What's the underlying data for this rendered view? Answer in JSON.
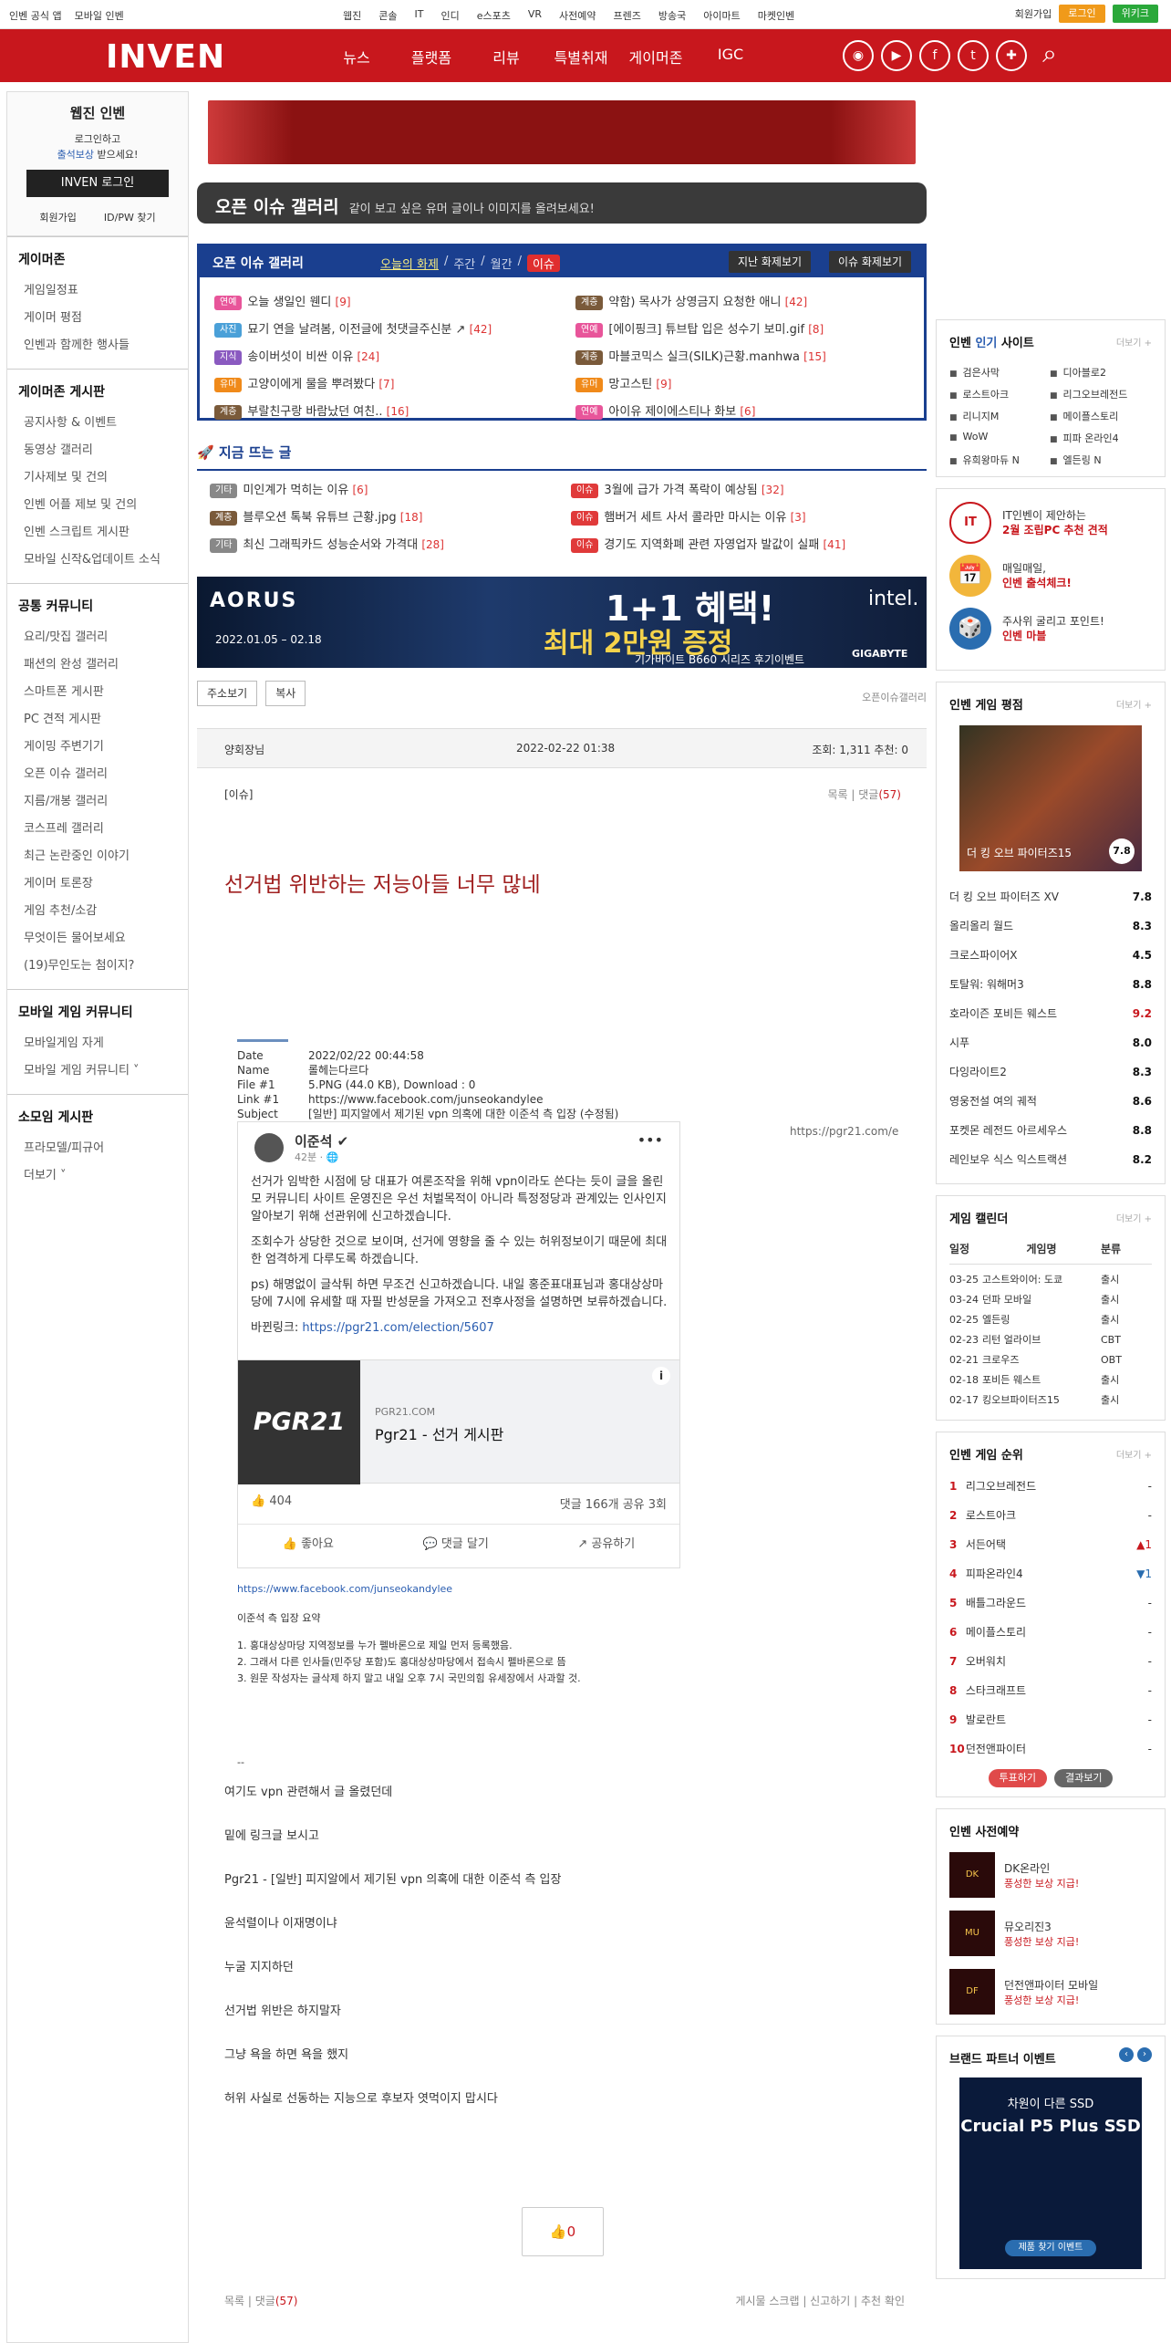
{
  "topbar": {
    "left": [
      "인벤 공식 앱",
      "모바일 인벤"
    ],
    "center": [
      "웹진",
      "콘솔",
      "IT",
      "인디",
      "e스포츠",
      "VR",
      "사전예약",
      "프렌즈",
      "방송국",
      "아이마트",
      "마켓인벤"
    ],
    "join": "회원가입",
    "login": "로그인",
    "kw": "위키크"
  },
  "header": {
    "logo": "INVEN",
    "nav": [
      "뉴스",
      "플랫폼",
      "리뷰",
      "특별취재",
      "게이머존",
      "IGC"
    ]
  },
  "left": {
    "title": "웹진 인벤",
    "msg1": "로그인하고",
    "msg2a": "출석보상",
    "msg2b": " 받으세요!",
    "loginbtn": "INVEN 로그인",
    "join": "회원가입",
    "findid": "ID/PW 찾기",
    "sections": [
      {
        "title": "게이머존",
        "items": [
          "게임일정표",
          "게이머 평점",
          "인벤과 함께한 행사들"
        ]
      },
      {
        "title": "게이머존 게시판",
        "items": [
          "공지사항 & 이벤트",
          "동영상 갤러리",
          "기사제보 및 건의",
          "인벤 어플 제보 및 건의",
          "인벤 스크립트 게시판",
          "모바일 신작&업데이트 소식"
        ]
      },
      {
        "title": "공통 커뮤니티",
        "items": [
          "요리/맛집 갤러리",
          "패션의 완성 갤러리",
          "스마트폰 게시판",
          "PC 견적 게시판",
          "게이밍 주변기기",
          "오픈 이슈 갤러리",
          "지름/개봉 갤러리",
          "코스프레 갤러리",
          "최근 논란중인 이야기",
          "게이머 토론장",
          "게임 추천/소감",
          "무엇이든 물어보세요",
          "(19)무인도는 첨이지?"
        ]
      },
      {
        "title": "모바일 게임 커뮤니티",
        "items": [
          "모바일게임 자게",
          "모바일 게임 커뮤니티 ˅"
        ]
      },
      {
        "title": "소모임 게시판",
        "items": [
          "프라모델/피규어",
          "더보기 ˅"
        ]
      }
    ]
  },
  "gallery": {
    "title": "오픈 이슈 갤러리",
    "desc": "같이 보고 싶은 유머 글이나 이미지를 올려보세요!",
    "box_title": "오픈 이슈 갤러리",
    "tabs": [
      "오늘의 화제",
      "주간",
      "월간",
      "이슈"
    ],
    "btn1": "지난 화제보기",
    "btn2": "이슈 화제보기",
    "rows": [
      {
        "tag": "연예",
        "color": "#e8559a",
        "t": "오늘 생일인 웬디",
        "c": "[9]"
      },
      {
        "tag": "계층",
        "color": "#7a5a3a",
        "t": "약함) 목사가 상영금지 요청한 애니",
        "c": "[42]"
      },
      {
        "tag": "사진",
        "color": "#4aa0d8",
        "t": "묘기 연을 날려봄, 이전글에 첫댓글주신분 ↗",
        "c": "[42]"
      },
      {
        "tag": "연예",
        "color": "#e8559a",
        "t": "[에이핑크] 튜브탑 입은 성수기 보미.gif",
        "c": "[8]"
      },
      {
        "tag": "지식",
        "color": "#8a5ac0",
        "t": "송이버섯이 비싼 이유",
        "c": "[24]"
      },
      {
        "tag": "계층",
        "color": "#7a5a3a",
        "t": "마블코믹스 실크(SILK)근황.manhwa",
        "c": "[15]"
      },
      {
        "tag": "유머",
        "color": "#f08a1a",
        "t": "고양이에게 물을 뿌려봤다",
        "c": "[7]"
      },
      {
        "tag": "유머",
        "color": "#f08a1a",
        "t": "망고스틴",
        "c": "[9]"
      },
      {
        "tag": "계층",
        "color": "#7a5a3a",
        "t": "부랄친구랑 바람났던 여친..",
        "c": "[16]"
      },
      {
        "tag": "연예",
        "color": "#e8559a",
        "t": "아이유 제이에스티나 화보",
        "c": "[6]"
      }
    ]
  },
  "hot": {
    "title": "지금 뜨는 글",
    "rows": [
      {
        "tag": "기타",
        "color": "#888",
        "t": "미인계가 먹히는 이유",
        "c": "[6]"
      },
      {
        "tag": "이슈",
        "color": "#e03a3a",
        "t": "3월에 급가 가격 폭락이 예상됨",
        "c": "[32]"
      },
      {
        "tag": "계층",
        "color": "#7a5a3a",
        "t": "블루오션 톡북 유튜브 근황.jpg",
        "c": "[18]"
      },
      {
        "tag": "이슈",
        "color": "#e03a3a",
        "t": "햄버거 세트 사서 콜라만 마시는 이유",
        "c": "[3]"
      },
      {
        "tag": "기타",
        "color": "#888",
        "t": "최신 그래픽카드 성능순서와 가격대",
        "c": "[28]"
      },
      {
        "tag": "이슈",
        "color": "#e03a3a",
        "t": "경기도 지역화폐 관련 자영업자 발값이 실패",
        "c": "[41]"
      }
    ]
  },
  "ad": {
    "brand": "AORUS",
    "date": "2022.01.05 – 02.18",
    "promo1": "1+1 혜택!",
    "promo2": "최대 2만원 증정",
    "sub": "기가바이트 B660 시리즈 후기이벤트",
    "intel": "intel.",
    "giga": "GIGABYTE"
  },
  "actions": {
    "addr": "주소보기",
    "copy": "복사",
    "crumb": "오픈이슈갤러리"
  },
  "post": {
    "nick": "양회장님",
    "date": "2022-02-22 01:38",
    "stat": "조회: 1,311    추천: 0",
    "cat": "[이슈]",
    "list": "목록 | 댓글",
    "cmt": "(57)",
    "title": "선거법 위반하는 저능아들 너무 많네"
  },
  "embed": {
    "date_k": "Date",
    "date_v": "2022/02/22 00:44:58",
    "name_k": "Name",
    "name_v": "롤헤는다르다",
    "file_k": "File #1",
    "file_v": "5.PNG (44.0 KB), Download : 0",
    "link_k": "Link #1",
    "link_v": "https://www.facebook.com/junseokandylee",
    "subj_k": "Subject",
    "subj_v": "[일반] 피지알에서 제기된 vpn 의혹에 대한 이준석 측 입장 (수정됨)",
    "url": "https://pgr21.com/e",
    "fb_name": "이준석 ✔",
    "fb_time": "42분 · 🌐",
    "fb_p1": "선거가 임박한 시점에 당 대표가 여론조작을 위해 vpn이라도 쓴다는 듯이 글을 올린 모 커뮤니티 사이트 운영진은 우선 처벌목적이 아니라 특정정당과 관계있는 인사인지 알아보기 위해 선관위에 신고하겠습니다.",
    "fb_p2": "조회수가 상당한 것으로 보이며, 선거에 영향을 줄 수 있는 허위정보이기 때문에 최대한 엄격하게 다루도록 하겠습니다.",
    "fb_p3": "ps) 해명없이 글삭튀 하면 무조건 신고하겠습니다. 내일 홍준표대표님과 홍대상상마당에 7시에 유세할 때 자필 반성문을 가져오고 전후사정을 설명하면 보류하겠습니다.",
    "fb_p4a": "바뀐링크: ",
    "fb_p4b": "https://pgr21.com/election/5607",
    "card_thumb": "PGR21",
    "card_dom": "PGR21.COM",
    "card_title": "Pgr21 - 선거 게시판",
    "likes": "👍 404",
    "comments": "댓글 166개  공유 3회",
    "act1": "👍 좋아요",
    "act2": "💬 댓글 달기",
    "act3": "↗ 공유하기",
    "fb_link": "https://www.facebook.com/junseokandylee",
    "summary_title": "이준석 측 입장 요약",
    "s1": "1. 홍대상상마당 지역정보를 누가 펠바론으로 제일 먼저 등록했음.",
    "s2": "2. 그래서 다른 인사들(민주당 포함)도 홍대상상마당에서 접속시 펠바론으로 뜸",
    "s3": "3. 원문 작성자는 글삭제 하지 말고 내일 오후 7시 국민의힘 유세장에서 사과할 것.",
    "dash": "--"
  },
  "body": [
    "여기도 vpn 관련해서 글 올렸던데",
    "밑에 링크글 보시고",
    "Pgr21 - [일반] 피지알에서 제기된 vpn 의혹에 대한 이준석 측 입장",
    "윤석렬이나 이재명이냐",
    "누굴 지지하던",
    "선거법 위반은 하지말자",
    "그냥 욕을 하면 욕을 했지",
    "허위 사실로 선동하는 지능으로 후보자 엿먹이지 맙시다"
  ],
  "like_count": "0",
  "foot": {
    "left": "목록 | 댓글",
    "cmt": "(57)",
    "right": "게시물 스크랩 | 신고하기 | 추천 확인"
  },
  "right": {
    "sites_title_a": "인벤 ",
    "sites_title_b": "인기",
    "sites_title_c": " 사이트",
    "more": "더보기 +",
    "sites": [
      "검은사막",
      "디아블로2",
      "로스트아크",
      "리그오브레전드",
      "리니지M",
      "메이플스토리",
      "WoW",
      "피파 온라인4",
      "유희왕마듀 N",
      "엘든링 N"
    ],
    "promos": [
      {
        "icon": "IT",
        "l1": "IT인벤이 제안하는",
        "l2": "2월 조립PC 추천 견적"
      },
      {
        "icon": "📅",
        "l1": "매일매일,",
        "l2": "인벤 출석체크!"
      },
      {
        "icon": "🎲",
        "l1": "주사위 굴리고 포인트!",
        "l2": "인벤 마블"
      }
    ],
    "rating_title": "인벤 게임 평점",
    "rating_cap": "더 킹 오브 파이터즈15",
    "rating_score": "7.8",
    "ratings": [
      {
        "n": "더 킹 오브 파이터즈 XV",
        "v": "7.8",
        "hi": false
      },
      {
        "n": "올리올리 월드",
        "v": "8.3",
        "hi": false
      },
      {
        "n": "크로스파이어X",
        "v": "4.5",
        "hi": false
      },
      {
        "n": "토탈워: 워해머3",
        "v": "8.8",
        "hi": false
      },
      {
        "n": "호라이즌 포비든 웨스트",
        "v": "9.2",
        "hi": true
      },
      {
        "n": "시푸",
        "v": "8.0",
        "hi": false
      },
      {
        "n": "다잉라이트2",
        "v": "8.3",
        "hi": false
      },
      {
        "n": "영웅전설 여의 궤적",
        "v": "8.6",
        "hi": false
      },
      {
        "n": "포켓몬 레전드 아르세우스",
        "v": "8.8",
        "hi": false
      },
      {
        "n": "레인보우 식스 익스트랙션",
        "v": "8.2",
        "hi": false
      }
    ],
    "cal_title": "게임 캘린더",
    "cal_head": [
      "일정",
      "게임명",
      "분류"
    ],
    "cal": [
      [
        "03-25",
        "고스트와이어: 도쿄",
        "출시"
      ],
      [
        "03-24",
        "던파 모바일",
        "출시"
      ],
      [
        "02-25",
        "엘든링",
        "출시"
      ],
      [
        "02-23",
        "리턴 얼라이브",
        "CBT"
      ],
      [
        "02-21",
        "크로우즈",
        "OBT"
      ],
      [
        "02-18",
        "포비든 웨스트",
        "출시"
      ],
      [
        "02-17",
        "킹오브파이터즈15",
        "출시"
      ]
    ],
    "grank_title": "인벤 게임 순위",
    "granks": [
      {
        "n": "1",
        "g": "리그오브레전드",
        "d": "-",
        "cls": ""
      },
      {
        "n": "2",
        "g": "로스트아크",
        "d": "-",
        "cls": ""
      },
      {
        "n": "3",
        "g": "서든어택",
        "d": "▲1",
        "cls": "up"
      },
      {
        "n": "4",
        "g": "피파온라인4",
        "d": "▼1",
        "cls": "dn"
      },
      {
        "n": "5",
        "g": "배틀그라운드",
        "d": "-",
        "cls": ""
      },
      {
        "n": "6",
        "g": "메이플스토리",
        "d": "-",
        "cls": ""
      },
      {
        "n": "7",
        "g": "오버워치",
        "d": "-",
        "cls": ""
      },
      {
        "n": "8",
        "g": "스타크래프트",
        "d": "-",
        "cls": ""
      },
      {
        "n": "9",
        "g": "발로란트",
        "d": "-",
        "cls": ""
      },
      {
        "n": "10",
        "g": "던전앤파이터",
        "d": "-",
        "cls": ""
      }
    ],
    "vote": "투표하기",
    "result": "결과보기",
    "pre_title": "인벤 사전예약",
    "pre": [
      {
        "img": "DK",
        "n": "DK온라인",
        "s": "풍성한 보상 지급!"
      },
      {
        "img": "MU",
        "n": "뮤오리진3",
        "s": "풍성한 보상 지급!"
      },
      {
        "img": "DF",
        "n": "던전앤파이터 모바일",
        "s": "풍성한 보상 지급!"
      }
    ],
    "brand_title": "브랜드 파트너 이벤트",
    "brand_l1": "차원이 다른 SSD",
    "brand_l2": "Crucial P5 Plus SSD",
    "brand_btn": "제품 찾기 이벤트"
  },
  "colors": {
    "brand": "#c8171d",
    "navy": "#1a3f8f"
  }
}
